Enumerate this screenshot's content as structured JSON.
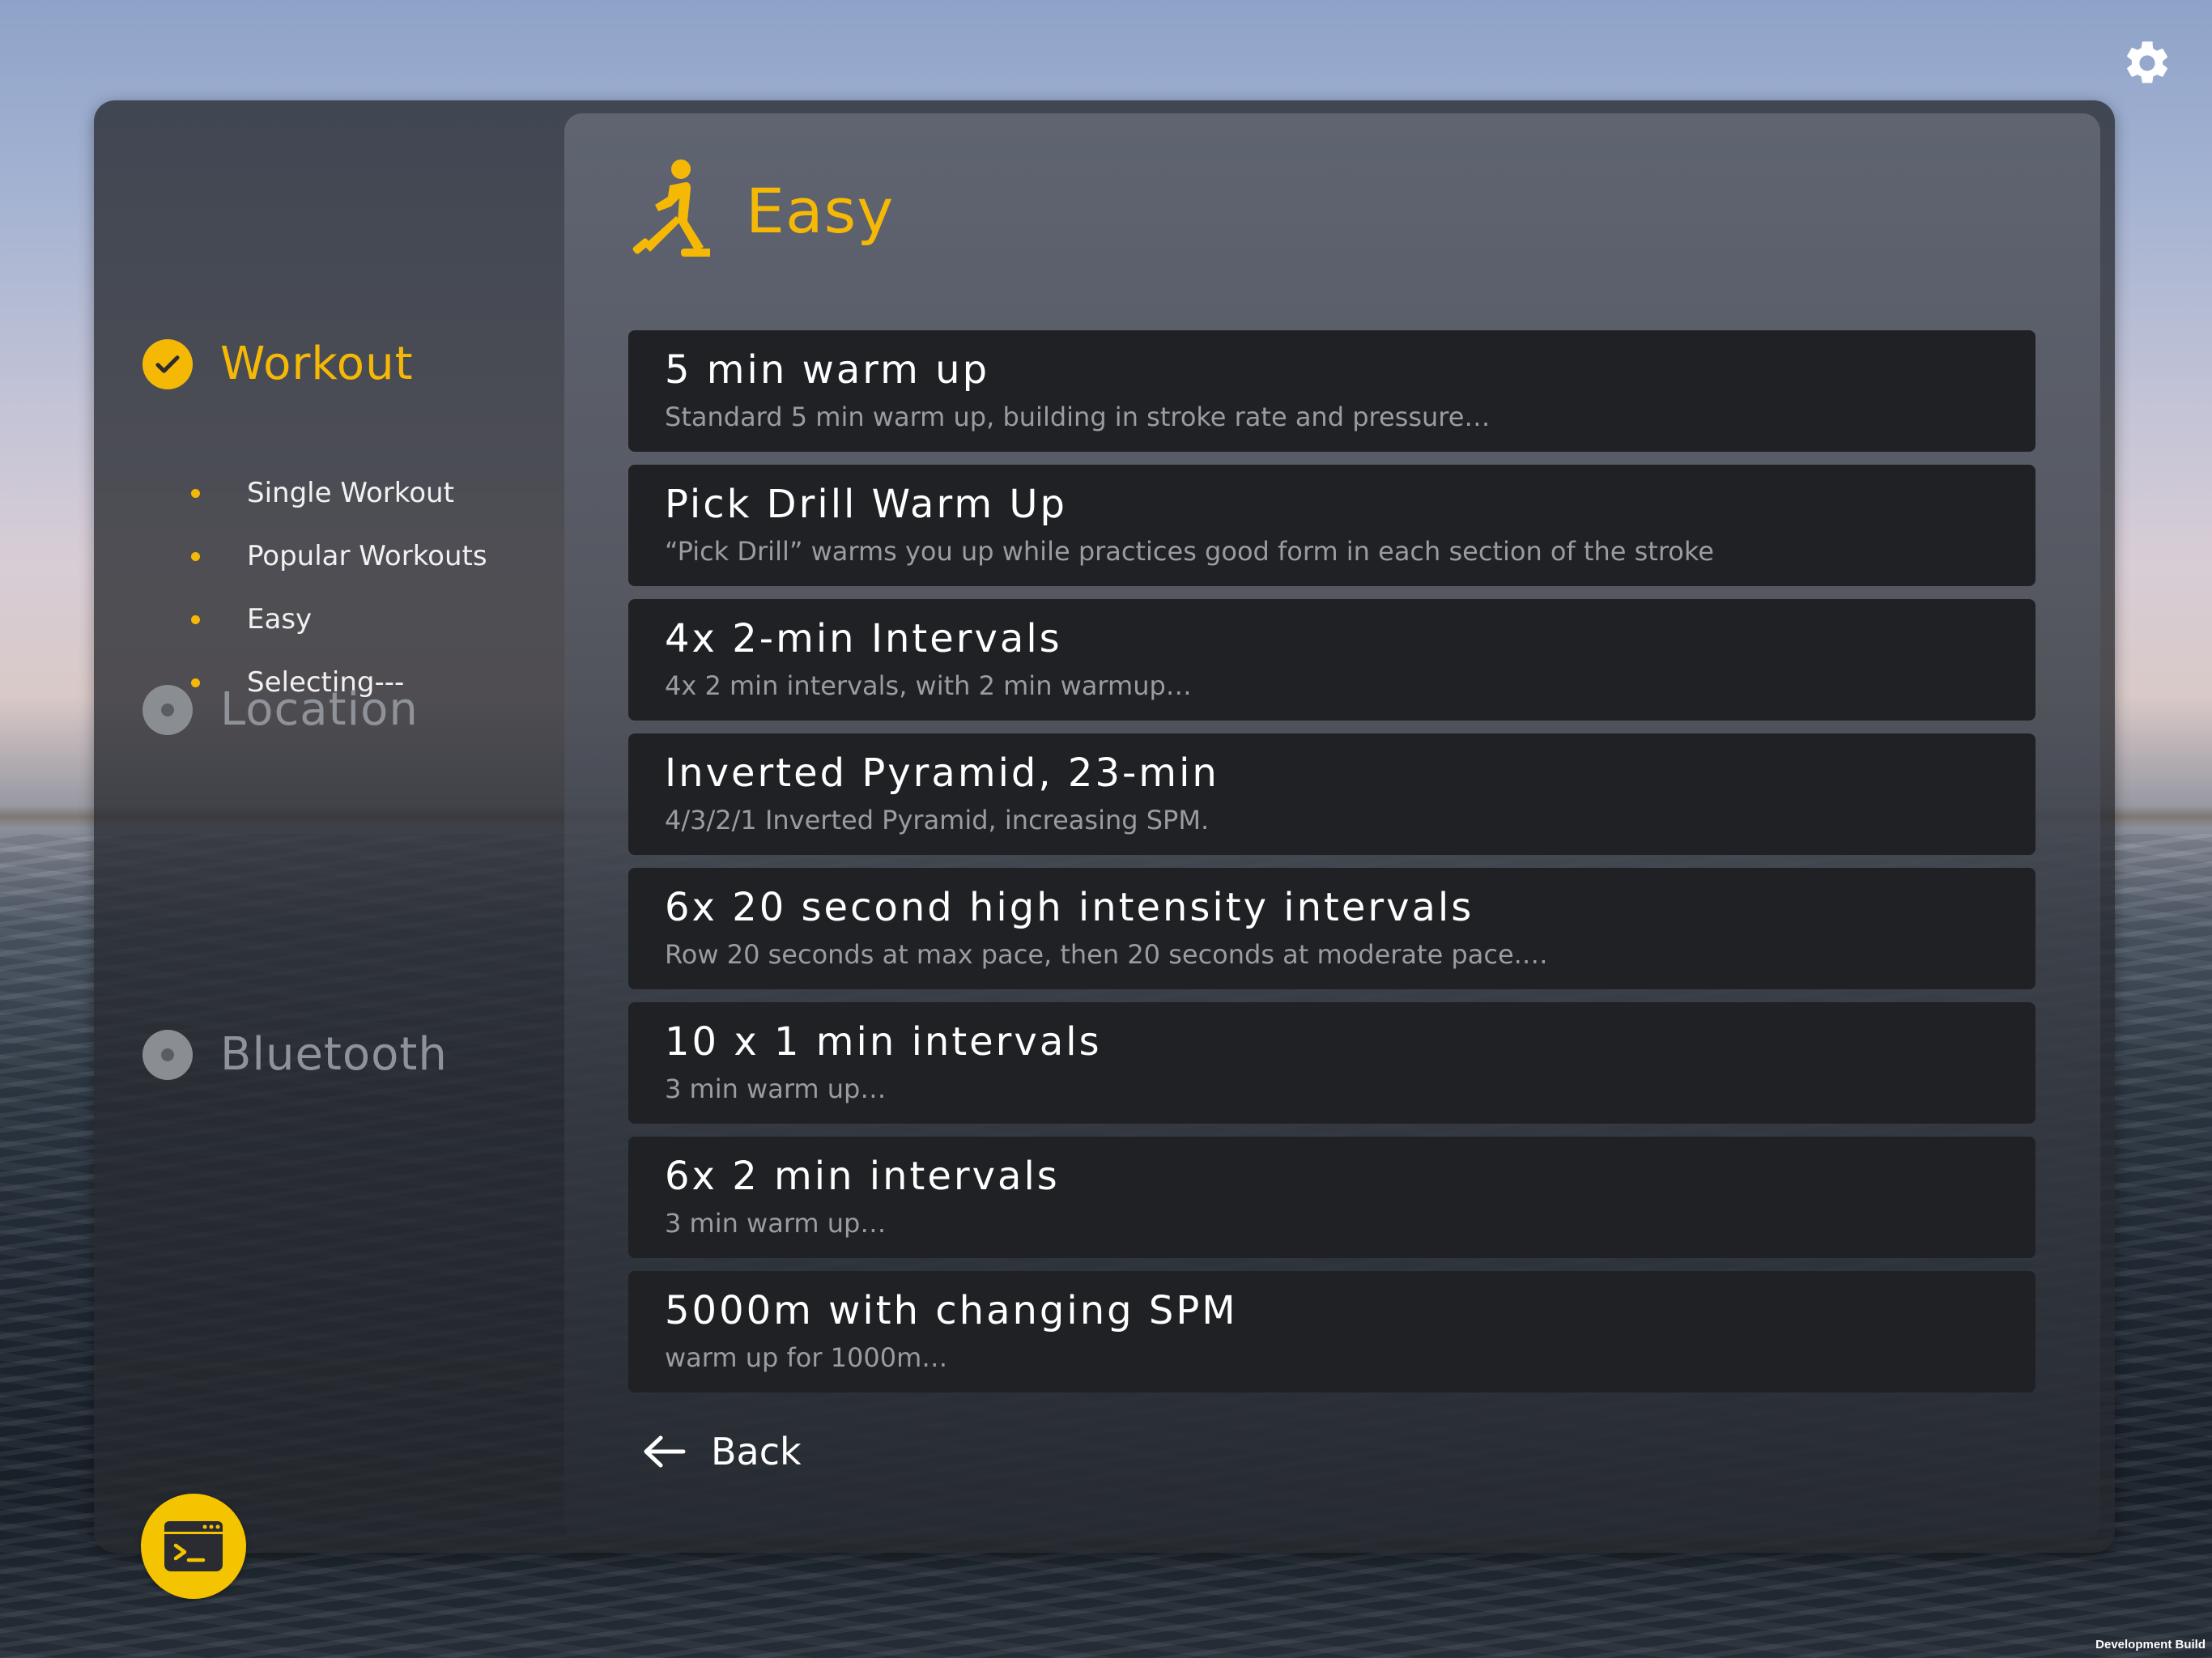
{
  "sidebar": {
    "steps": [
      {
        "label": "Workout",
        "state": "completed"
      },
      {
        "label": "Location",
        "state": "pending"
      },
      {
        "label": "Bluetooth",
        "state": "pending"
      }
    ],
    "substeps": [
      "Single Workout",
      "Popular Workouts",
      "Easy",
      "Selecting---"
    ]
  },
  "header": {
    "title": "Easy",
    "icon": "rower-icon"
  },
  "workouts": [
    {
      "name": "5 min warm up",
      "description": "Standard 5 min warm up, building in stroke rate and pressure…"
    },
    {
      "name": "Pick Drill Warm Up",
      "description": "“Pick Drill” warms you up while practices good form in each section of the stroke"
    },
    {
      "name": "4x 2-min Intervals",
      "description": "4x 2 min intervals, with 2 min warmup…"
    },
    {
      "name": "Inverted Pyramid, 23-min",
      "description": "4/3/2/1 Inverted Pyramid, increasing SPM."
    },
    {
      "name": "6x 20 second high intensity intervals",
      "description": "Row 20 seconds at max pace, then 20 seconds at moderate pace.…"
    },
    {
      "name": "10 x 1 min intervals",
      "description": "3 min warm up…"
    },
    {
      "name": "6x 2 min intervals",
      "description": "3 min warm up…"
    },
    {
      "name": "5000m with changing SPM",
      "description": "warm up for 1000m…"
    }
  ],
  "back_label": "Back",
  "footer": {
    "dev_build": "Development Build"
  },
  "colors": {
    "accent": "#f5b905",
    "card_bg": "#1f2125",
    "inactive": "#8f9298"
  },
  "icons": {
    "settings": "gear-icon",
    "console": "console-icon",
    "back": "arrow-left-icon",
    "completed_step": "check-circle-icon",
    "pending_step": "radio-dot-icon"
  }
}
